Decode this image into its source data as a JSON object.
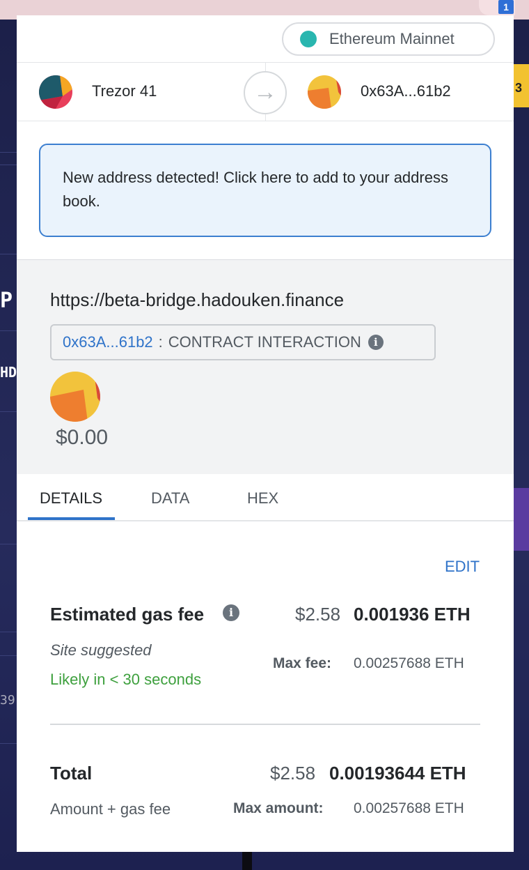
{
  "browser": {
    "extension_badge": "1"
  },
  "background": {
    "right_tab_text": "3",
    "left_glyph_1": "P",
    "left_glyph_2": "HD",
    "left_glyph_3": "39"
  },
  "network": {
    "label": "Ethereum Mainnet",
    "dot_color": "#29b6af"
  },
  "accounts": {
    "from_name": "Trezor 41",
    "to_address": "0x63A...61b2"
  },
  "notice": {
    "text": "New address detected! Click here to add to your address book."
  },
  "summary": {
    "origin": "https://beta-bridge.hadouken.finance",
    "method_address": "0x63A...61b2",
    "method_separator": ":",
    "method_name": "CONTRACT INTERACTION",
    "amount": "$0.00"
  },
  "tabs": [
    {
      "label": "DETAILS",
      "active": true
    },
    {
      "label": "DATA",
      "active": false
    },
    {
      "label": "HEX",
      "active": false
    }
  ],
  "gas": {
    "edit_label": "EDIT",
    "title": "Estimated gas fee",
    "usd": "$2.58",
    "eth": "0.001936 ETH",
    "site_suggested": "Site suggested",
    "likely": "Likely in < 30 seconds",
    "max_fee_label": "Max fee:",
    "max_fee_value": "0.00257688 ETH"
  },
  "total": {
    "title": "Total",
    "usd": "$2.58",
    "eth": "0.00193644 ETH",
    "subtitle": "Amount + gas fee",
    "max_amount_label": "Max amount:",
    "max_amount_value": "0.00257688 ETH"
  },
  "colors": {
    "accent": "#2f73c9",
    "success": "#3ea03e",
    "notice_bg": "#eaf3fc"
  }
}
